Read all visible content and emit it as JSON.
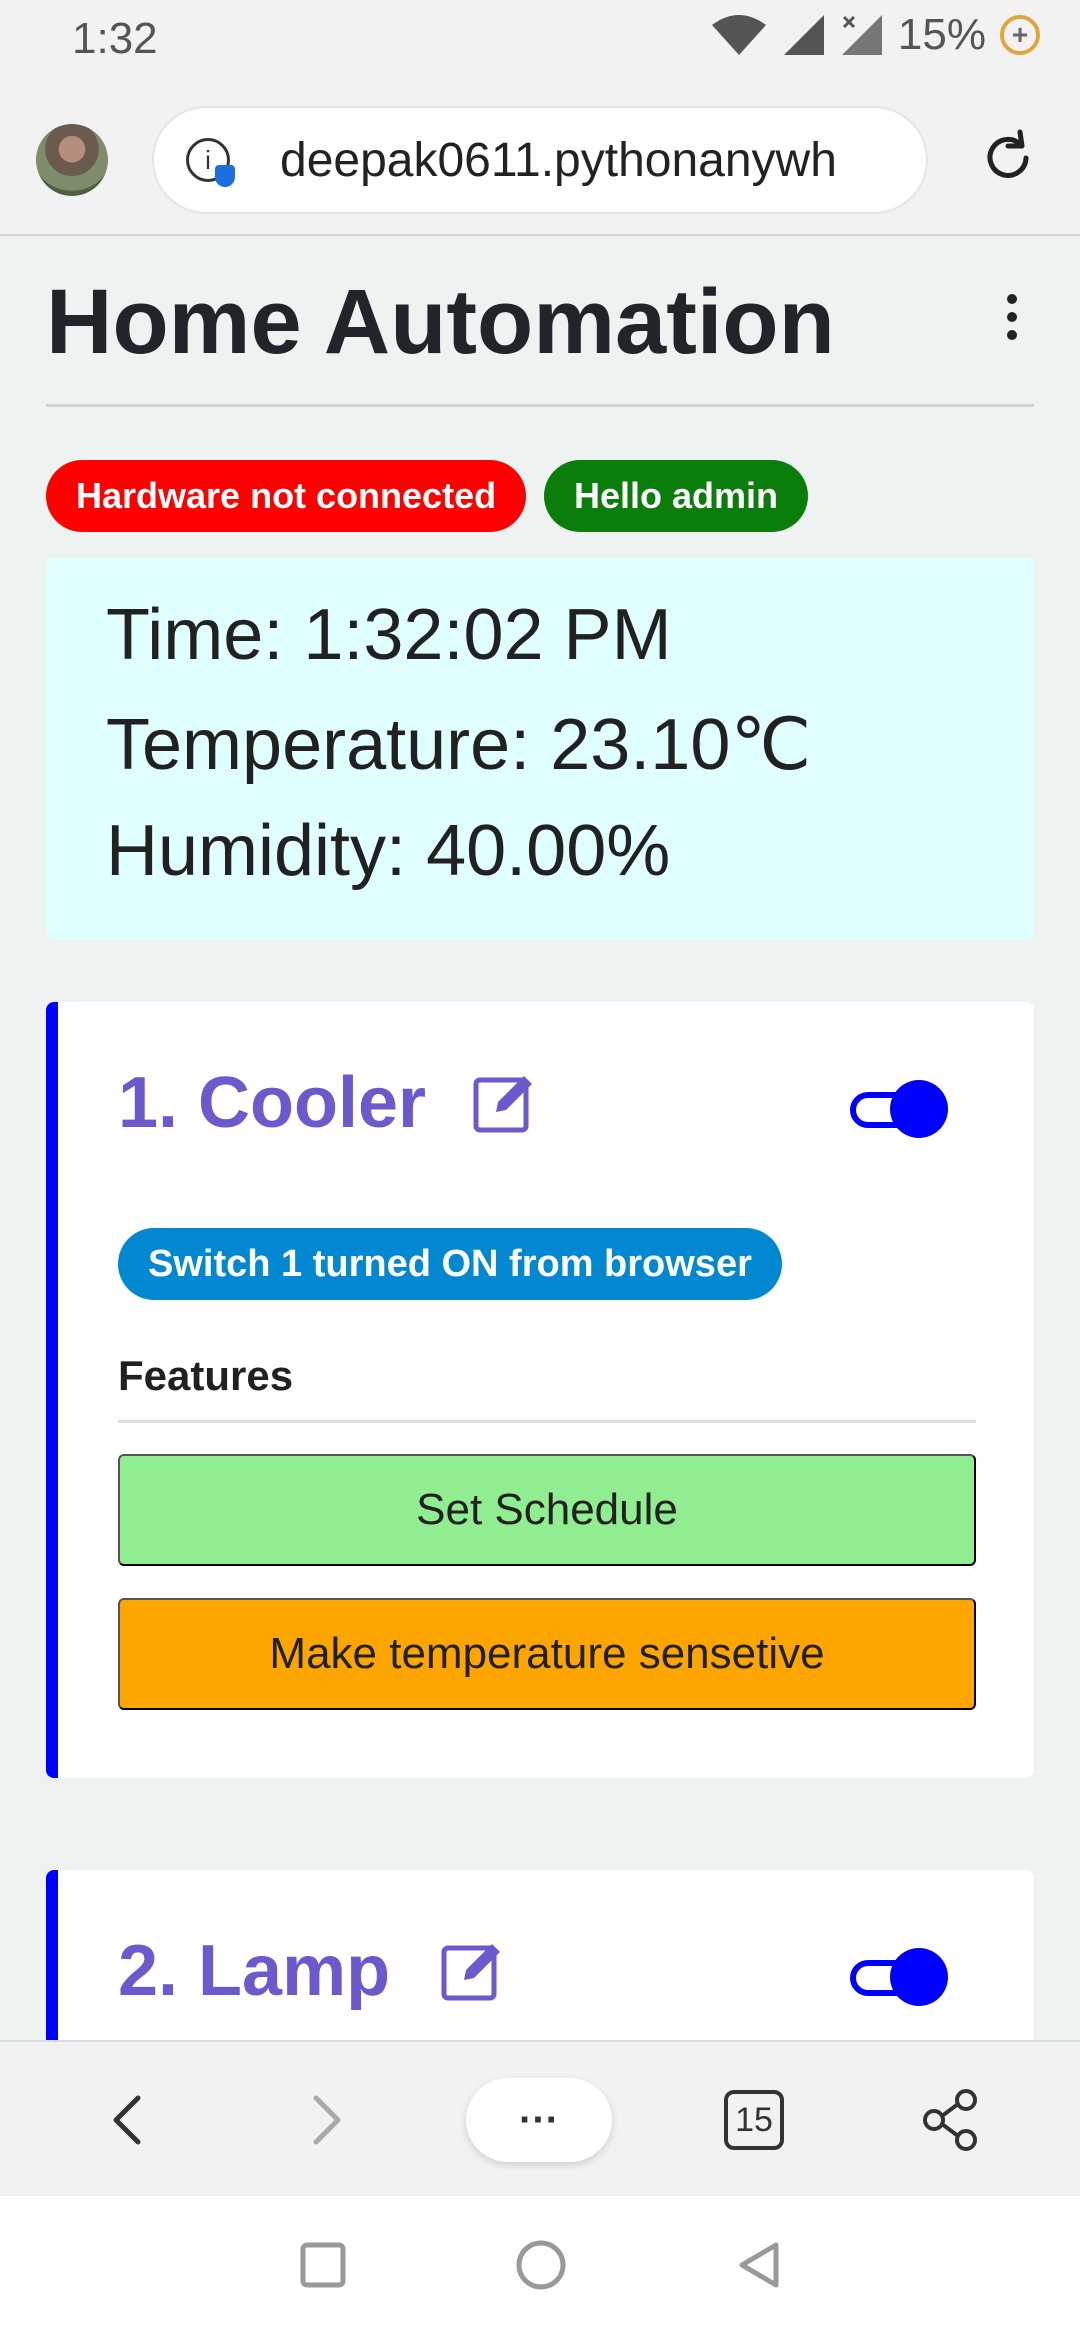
{
  "status_bar": {
    "time": "1:32",
    "battery": "15%"
  },
  "browser": {
    "url": "deepak0611.pythonanywh",
    "tab_count": "15",
    "more_label": "···"
  },
  "page": {
    "title": "Home Automation",
    "badges": {
      "hardware": "Hardware not connected",
      "greeting": "Hello admin"
    },
    "readings": {
      "time": "Time: 1:32:02 PM",
      "temperature": "Temperature: 23.10℃",
      "humidity": "Humidity: 40.00%"
    },
    "devices": [
      {
        "name": "1.  Cooler",
        "switch_on": true,
        "status": "Switch 1 turned ON from browser",
        "features_label": "Features",
        "schedule_button": "Set Schedule",
        "temperature_button": "Make temperature sensetive"
      },
      {
        "name": "2.  Lamp",
        "switch_on": true
      }
    ]
  },
  "colors": {
    "card_accent": "#0000ff",
    "device_name": "#6a5acd",
    "badge_red": "#ff0000",
    "badge_green": "#0a7d0a",
    "status_pill": "#0288d1",
    "schedule_button": "#90ee90",
    "temperature_button": "#ffa500",
    "info_box": "#e0ffff"
  }
}
